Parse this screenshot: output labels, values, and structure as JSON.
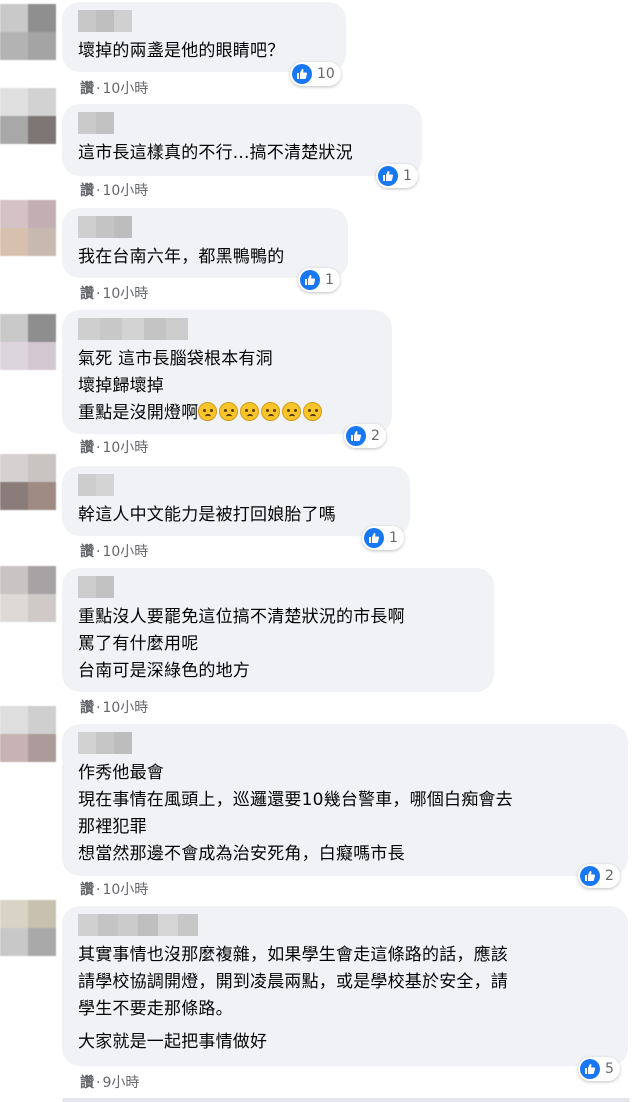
{
  "colors": {
    "bubble_bg": "#f0f2f5",
    "like_blue": "#1877f2",
    "meta_gray": "#65676b"
  },
  "icons": {
    "reaction": "like-thumbs-up-icon",
    "emoji": "sad-face-emoji-icon"
  },
  "comments": [
    {
      "lines": [
        "壞掉的兩盞是他的眼睛吧？"
      ],
      "reaction_count": "10",
      "action": "讚",
      "time": "10小時"
    },
    {
      "lines": [
        "這市長這樣真的不行...搞不清楚狀況"
      ],
      "reaction_count": "1",
      "action": "讚",
      "time": "10小時"
    },
    {
      "lines": [
        "我在台南六年，都黑鴨鴨的"
      ],
      "reaction_count": "1",
      "action": "讚",
      "time": "10小時"
    },
    {
      "lines": [
        "氣死 這市長腦袋根本有洞",
        "壞掉歸壞掉",
        "重點是沒開燈啊"
      ],
      "emoji_count": 6,
      "reaction_count": "2",
      "action": "讚",
      "time": "10小時"
    },
    {
      "lines": [
        "幹這人中文能力是被打回娘胎了嗎"
      ],
      "reaction_count": "1",
      "action": "讚",
      "time": "10小時"
    },
    {
      "lines": [
        "重點沒人要罷免這位搞不清楚狀況的市長啊",
        "罵了有什麼用呢",
        "台南可是深綠色的地方"
      ],
      "action": "讚",
      "time": "10小時"
    },
    {
      "lines": [
        "作秀他最會",
        "現在事情在風頭上，巡邏還要10幾台警車，哪個白痴會去",
        "那裡犯罪",
        "想當然那邊不會成為治安死角，白癡嗎市長"
      ],
      "reaction_count": "2",
      "action": "讚",
      "time": "10小時"
    },
    {
      "lines": [
        "其實事情也沒那麼複雜，如果學生會走這條路的話，應該",
        "請學校協調開燈，開到凌晨兩點，或是學校基於安全，請",
        "學生不要走那條路。"
      ],
      "lines2": [
        "大家就是一起把事情做好"
      ],
      "reaction_count": "5",
      "action": "讚",
      "time": "9小時"
    }
  ]
}
